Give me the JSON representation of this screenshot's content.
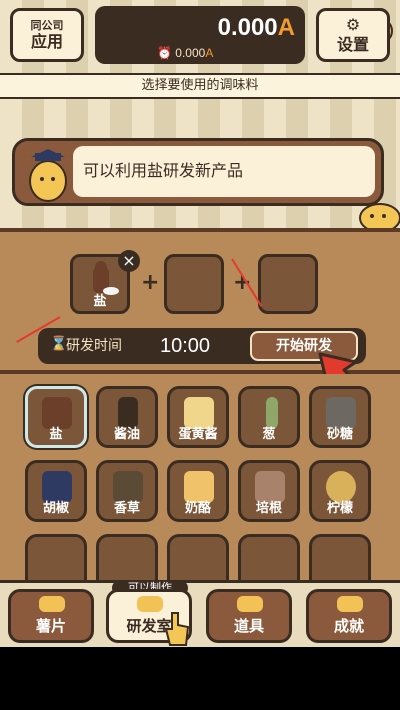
{
  "header": {
    "left_button": {
      "line1": "同公司",
      "line2": "应用"
    },
    "money": {
      "main_value": "0.000",
      "main_unit": "A",
      "sub_value": "0.000",
      "sub_unit": "A"
    },
    "settings_label": "设置"
  },
  "title_bar": "选择要使用的调味料",
  "speech": "可以利用盐研发新产品",
  "research": {
    "slot1_label": "盐",
    "plus": "+",
    "close_symbol": "×",
    "time_label": "研发时间",
    "time_value": "10:00",
    "start_label": "开始研发"
  },
  "ingredients": [
    {
      "label": "盐"
    },
    {
      "label": "酱油"
    },
    {
      "label": "蛋黄酱"
    },
    {
      "label": "葱"
    },
    {
      "label": "砂糖"
    },
    {
      "label": "胡椒"
    },
    {
      "label": "香草"
    },
    {
      "label": "奶酪"
    },
    {
      "label": "培根"
    },
    {
      "label": "柠檬"
    }
  ],
  "nav": {
    "badge": "可以制作",
    "items": [
      {
        "label": "薯片"
      },
      {
        "label": "研发室"
      },
      {
        "label": "道具"
      },
      {
        "label": "成就"
      }
    ]
  },
  "colors": {
    "dark_brown": "#3b2c22",
    "panel": "#b98a59",
    "accent_orange": "#f29b2e",
    "red_arrow": "#e23b2e"
  }
}
